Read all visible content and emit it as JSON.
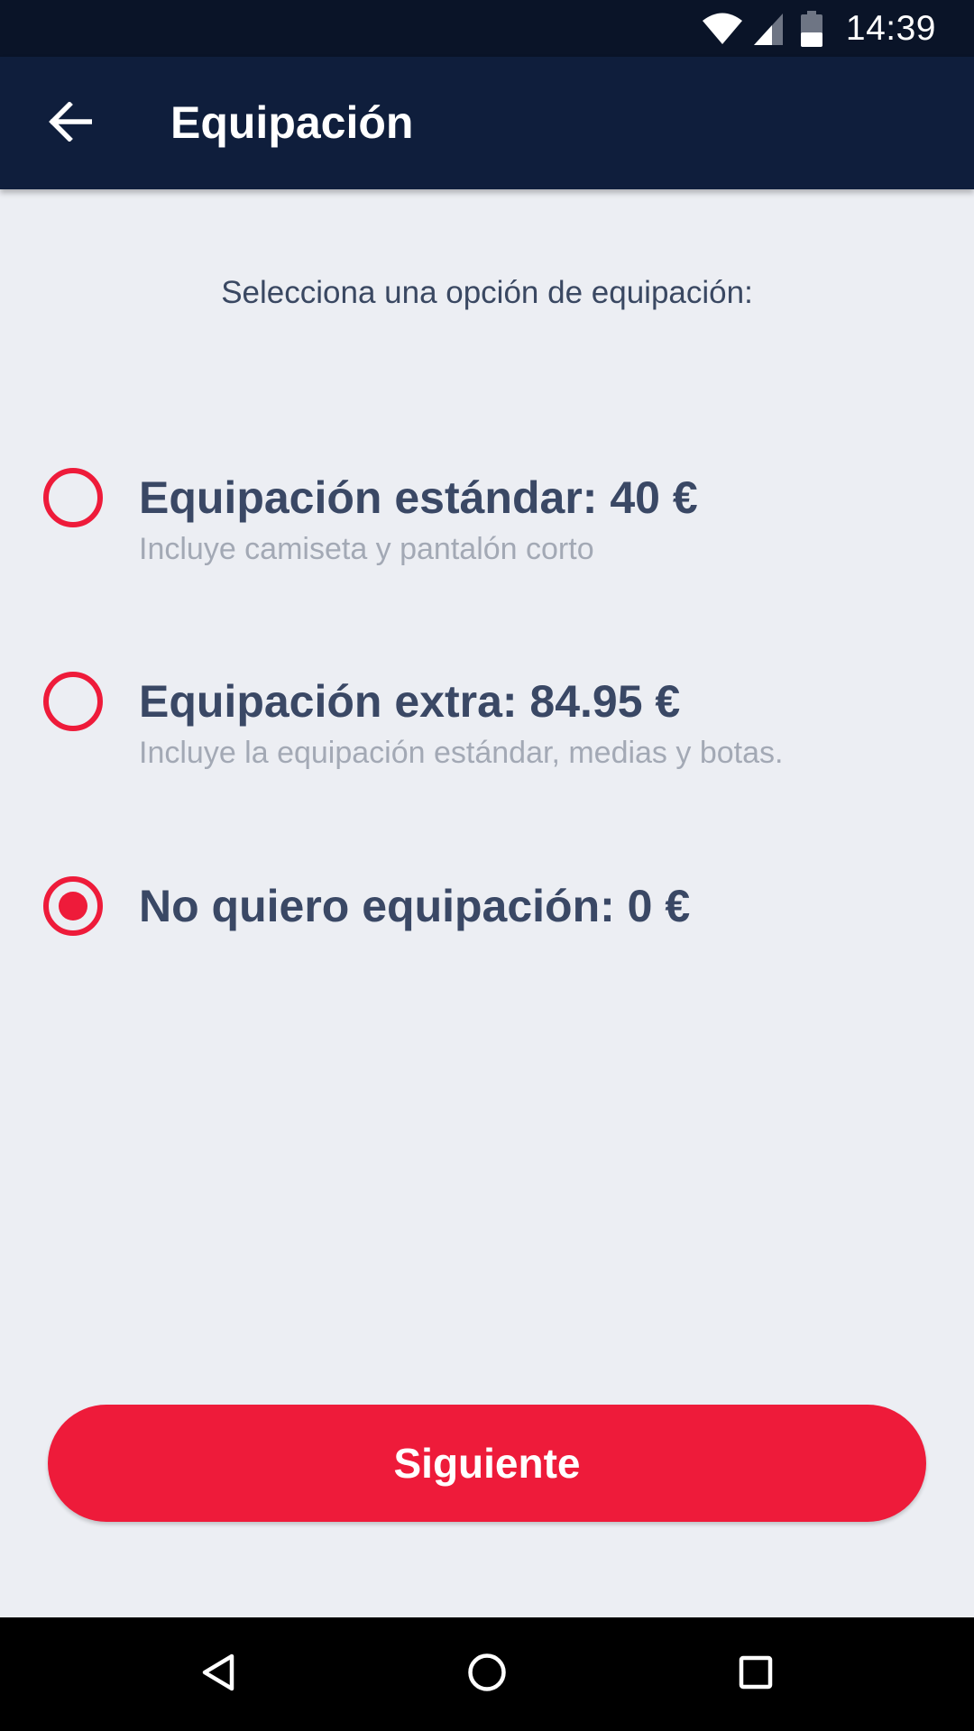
{
  "status_bar": {
    "time": "14:39",
    "icons": [
      "wifi-icon",
      "cell-signal-icon",
      "battery-icon"
    ]
  },
  "toolbar": {
    "back_icon": "arrow-back-icon",
    "title": "Equipación"
  },
  "main": {
    "prompt": "Selecciona una opción de equipación:",
    "options": [
      {
        "title": "Equipación estándar: 40 €",
        "description": "Incluye camiseta y pantalón corto",
        "selected": false
      },
      {
        "title": "Equipación extra: 84.95 €",
        "description": "Incluye la equipación estándar, medias y botas.",
        "selected": false
      },
      {
        "title": "No quiero equipación: 0 €",
        "description": "",
        "selected": true
      }
    ],
    "next_label": "Siguiente"
  },
  "nav_bar": {
    "icons": [
      "back-triangle-icon",
      "home-circle-icon",
      "recents-square-icon"
    ]
  },
  "colors": {
    "status_bar": "#0A1428",
    "toolbar": "#0F1E3C",
    "background": "#ECEEF3",
    "accent": "#EE1B3A",
    "title_text": "#3A4865",
    "secondary_text": "#A3A9B5"
  }
}
